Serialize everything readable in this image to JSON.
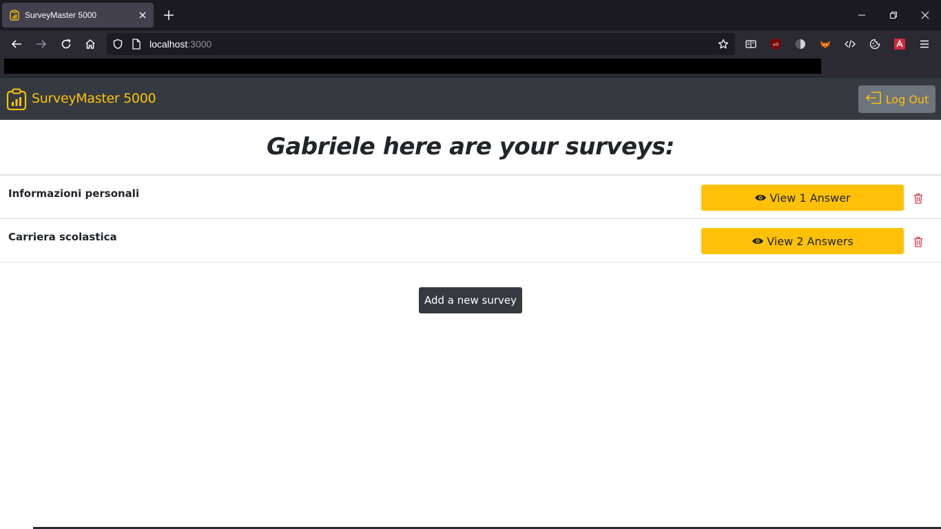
{
  "browser": {
    "tab_title": "SurveyMaster 5000",
    "url_host": "localhost",
    "url_port": ":3000"
  },
  "app": {
    "brand": "SurveyMaster 5000",
    "logout_label": "Log Out"
  },
  "main": {
    "title": "Gabriele here are your surveys:",
    "surveys": [
      {
        "name": "Informazioni personali",
        "view_label": "View 1 Answer"
      },
      {
        "name": "Carriera scolastica",
        "view_label": "View 2 Answers"
      }
    ],
    "add_label": "Add a new survey"
  },
  "colors": {
    "accent": "#ffc107",
    "header_bg": "#343a40",
    "danger": "#dc3545"
  }
}
